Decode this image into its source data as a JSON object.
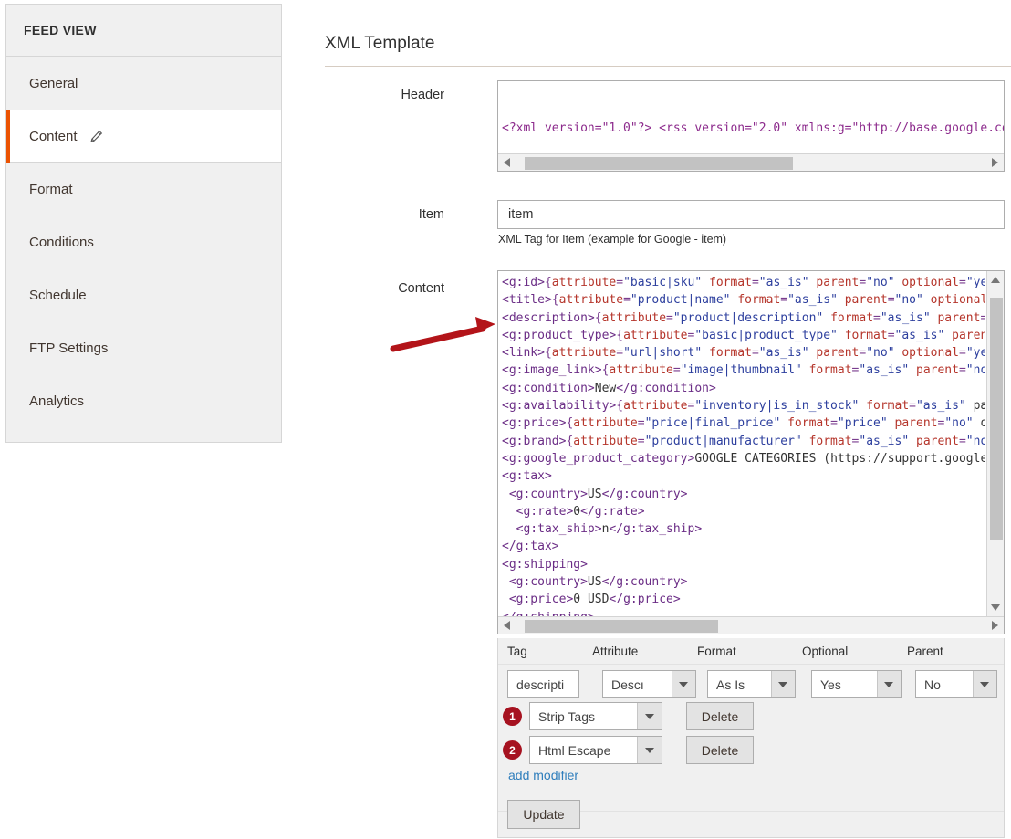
{
  "sidebar": {
    "title": "FEED VIEW",
    "items": [
      {
        "label": "General",
        "active": false,
        "icon": ""
      },
      {
        "label": "Content",
        "active": true,
        "icon": "pencil-icon"
      },
      {
        "label": "Format",
        "active": false,
        "icon": ""
      },
      {
        "label": "Conditions",
        "active": false,
        "icon": ""
      },
      {
        "label": "Schedule",
        "active": false,
        "icon": ""
      },
      {
        "label": "FTP Settings",
        "active": false,
        "icon": ""
      },
      {
        "label": "Analytics",
        "active": false,
        "icon": ""
      }
    ],
    "active_accent_color": "#eb5202"
  },
  "main": {
    "section_title": "XML Template",
    "header_field": {
      "label": "Header",
      "value": "<?xml version=\"1.0\"?> <rss version=\"2.0\" xmlns:g=\"http://base.google.com",
      "scroll_h_thumb_left_pct": 2,
      "scroll_h_thumb_width_pct": 57
    },
    "item_field": {
      "label": "Item",
      "value": "item",
      "hint": "XML Tag for Item (example for Google - item)"
    },
    "content_field": {
      "label": "Content",
      "lines": [
        "<g:id>{attribute=\"basic|sku\" format=\"as_is\" parent=\"no\" optional=\"yes",
        "<title>{attribute=\"product|name\" format=\"as_is\" parent=\"no\" optional=",
        "<description>{attribute=\"product|description\" format=\"as_is\" parent=\"",
        "<g:product_type>{attribute=\"basic|product_type\" format=\"as_is\" parent",
        "<link>{attribute=\"url|short\" format=\"as_is\" parent=\"no\" optional=\"yes",
        "<g:image_link>{attribute=\"image|thumbnail\" format=\"as_is\" parent=\"no\"",
        "<g:condition>New</g:condition>",
        "<g:availability>{attribute=\"inventory|is_in_stock\" format=\"as_is\" par",
        "<g:price>{attribute=\"price|final_price\" format=\"price\" parent=\"no\" op",
        "<g:brand>{attribute=\"product|manufacturer\" format=\"as_is\" parent=\"no\"",
        "<g:google_product_category>GOOGLE CATEGORIES (https://support.google.",
        "<g:tax>",
        " <g:country>US</g:country>",
        "  <g:rate>0</g:rate>",
        "  <g:tax_ship>n</g:tax_ship>",
        "</g:tax>",
        "<g:shipping>",
        " <g:country>US</g:country>",
        " <g:price>0 USD</g:price>",
        "</g:shipping>"
      ],
      "scroll_h_thumb_left_pct": 2,
      "scroll_h_thumb_width_pct": 41,
      "scroll_v_thumb_top_pct": 3,
      "scroll_v_thumb_height_pct": 78
    }
  },
  "modifier_panel": {
    "columns": [
      "Tag",
      "Attribute",
      "Format",
      "Optional",
      "Parent"
    ],
    "row": {
      "tag_value": "descripti",
      "attribute_value": "Descı",
      "format_value": "As Is",
      "optional_value": "Yes",
      "parent_value": "No"
    },
    "modifiers": [
      {
        "index": "1",
        "value": "Strip Tags",
        "delete_label": "Delete"
      },
      {
        "index": "2",
        "value": "Html Escape",
        "delete_label": "Delete"
      }
    ],
    "add_modifier_label": "add modifier",
    "update_label": "Update",
    "badge_color": "#a61220",
    "link_color": "#2f7ebc"
  },
  "annotation": {
    "arrow_color": "#b31419",
    "points_at": "description-line"
  }
}
